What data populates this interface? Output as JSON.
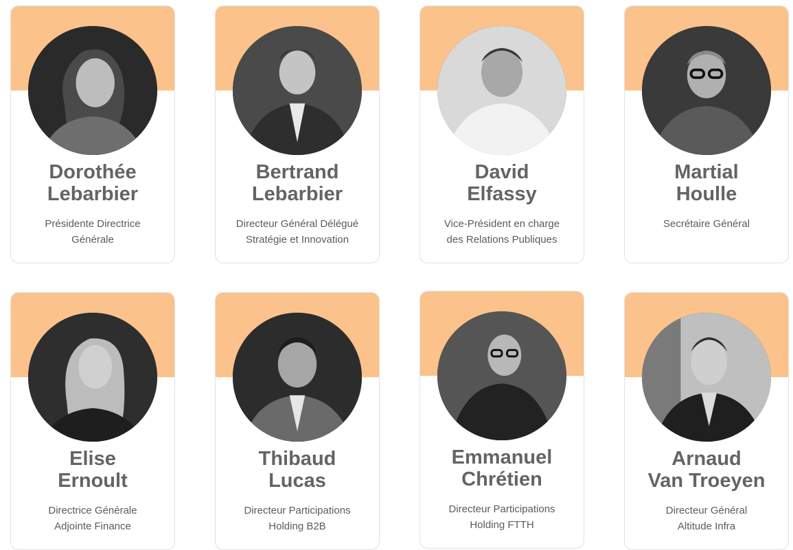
{
  "people": [
    {
      "first": "Dorothée",
      "last": "Lebarbier",
      "role_line1": "Présidente Directrice",
      "role_line2": "Générale",
      "photo": "woman-portrait-icon"
    },
    {
      "first": "Bertrand",
      "last": "Lebarbier",
      "role_line1": "Directeur Général Délégué",
      "role_line2": "Stratégie et Innovation",
      "photo": "man-portrait-icon"
    },
    {
      "first": "David",
      "last": "Elfassy",
      "role_line1": "Vice-Président en charge",
      "role_line2": "des Relations Publiques",
      "photo": "man-portrait-icon"
    },
    {
      "first": "Martial",
      "last": "Houlle",
      "role_line1": "Secrétaire Général",
      "role_line2": "",
      "photo": "man-portrait-icon"
    },
    {
      "first": "Elise",
      "last": "Ernoult",
      "role_line1": "Directrice Générale",
      "role_line2": "Adjointe Finance",
      "photo": "woman-portrait-icon"
    },
    {
      "first": "Thibaud",
      "last": "Lucas",
      "role_line1": "Directeur Participations",
      "role_line2": "Holding B2B",
      "photo": "man-portrait-icon"
    },
    {
      "first": "Emmanuel",
      "last": "Chrétien",
      "role_line1": "Directeur Participations",
      "role_line2": "Holding FTTH",
      "photo": "man-portrait-icon"
    },
    {
      "first": "Arnaud",
      "last": "Van Troeyen",
      "role_line1": "Directeur Général",
      "role_line2": "Altitude Infra",
      "photo": "man-portrait-icon"
    }
  ],
  "colors": {
    "band": "#fbc28b",
    "name": "#646464",
    "role": "#5b5b5b",
    "border": "#e2e2e2"
  }
}
